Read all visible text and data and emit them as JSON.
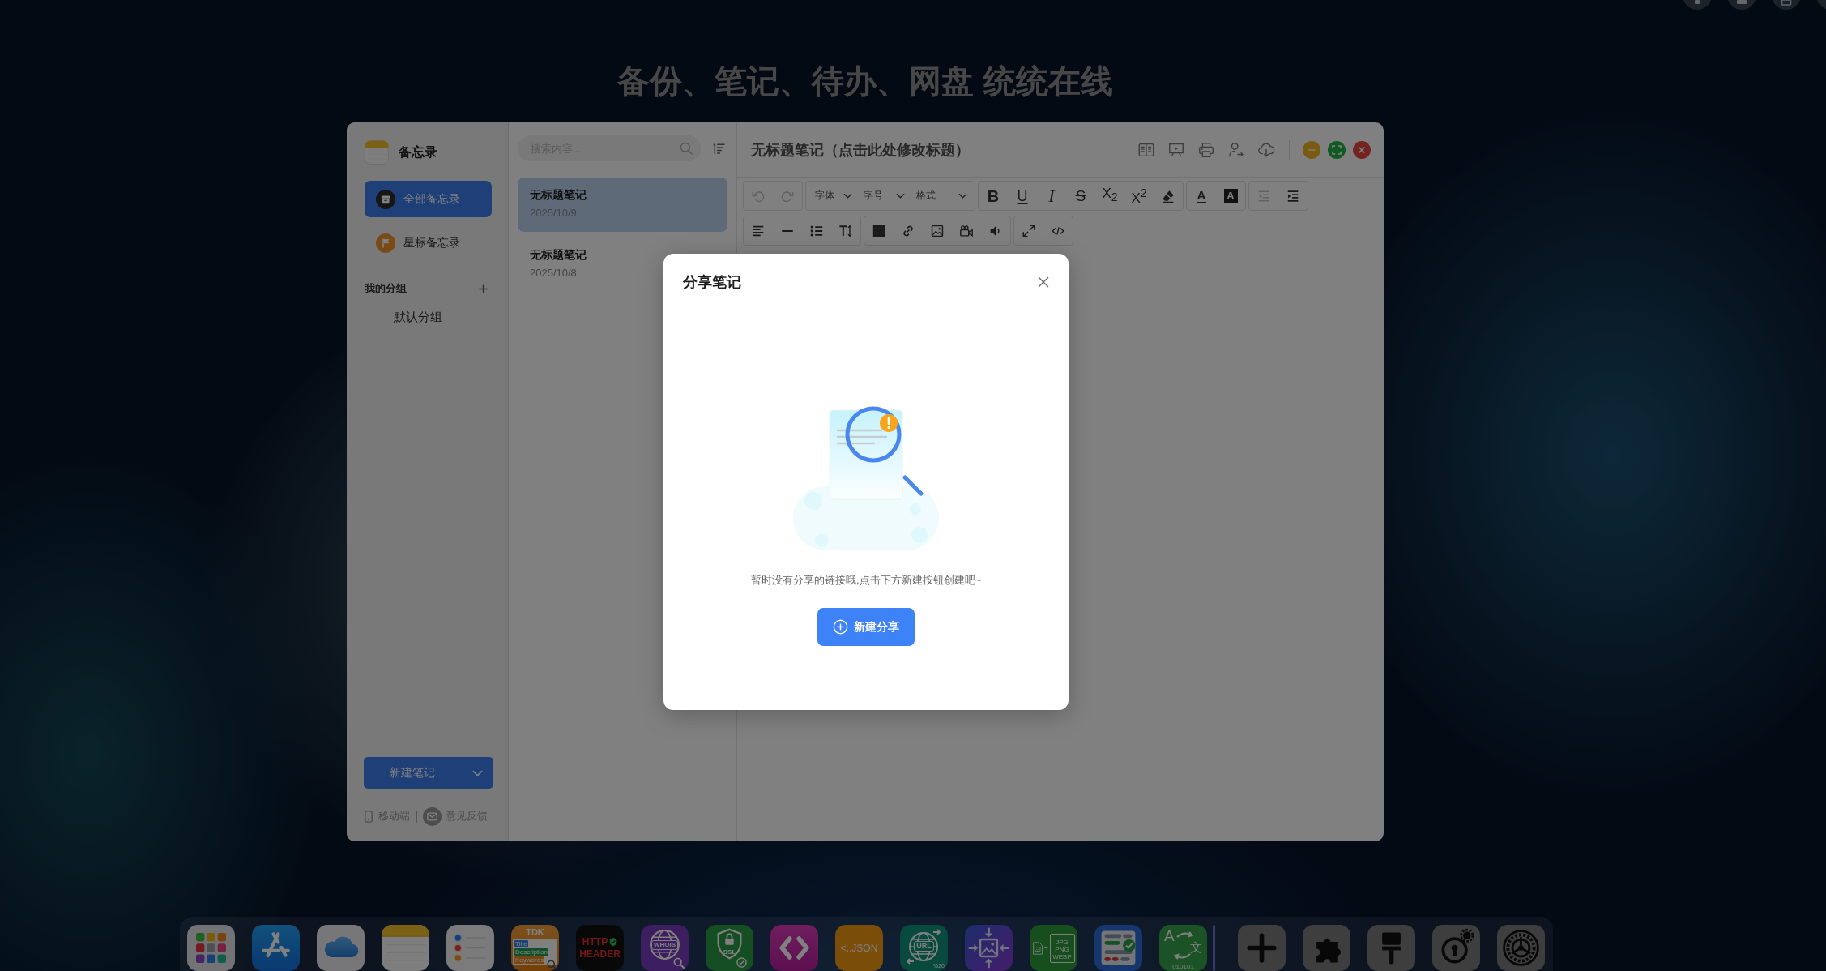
{
  "desktop": {
    "headline": "备份、笔记、待办、网盘 统统在线"
  },
  "sidebar": {
    "app_name": "备忘录",
    "nav": [
      {
        "kind": "all",
        "label": "全部备忘录",
        "selected": true
      },
      {
        "kind": "starred",
        "label": "星标备忘录",
        "selected": false
      }
    ],
    "groups_title": "我的分组",
    "groups": [
      {
        "label": "默认分组",
        "selected": false
      }
    ],
    "new_note": "新建笔记",
    "links": [
      {
        "kind": "mobile",
        "label": "移动端"
      },
      {
        "kind": "feedback",
        "label": "意见反馈"
      }
    ]
  },
  "note_list": {
    "search": {
      "placeholder": "搜索内容..."
    },
    "notes": [
      {
        "title": "无标题笔记",
        "date": "2025/10/9",
        "selected": true
      },
      {
        "title": "无标题笔记",
        "date": "2025/10/8",
        "selected": false
      }
    ]
  },
  "editor": {
    "title": "无标题笔记（点击此处修改标题）",
    "actions": [
      {
        "kind": "reader"
      },
      {
        "kind": "slides"
      },
      {
        "kind": "print"
      },
      {
        "kind": "share"
      },
      {
        "kind": "cloud"
      }
    ],
    "window_controls": [
      {
        "kind": "minimize"
      },
      {
        "kind": "maximize"
      },
      {
        "kind": "close"
      }
    ],
    "toolbar_rows": [
      {
        "groups": [
          {
            "items": [
              {
                "kind": "undo",
                "disabled": true
              },
              {
                "kind": "redo",
                "disabled": true
              }
            ]
          },
          {
            "items": [
              {
                "kind": "select",
                "label": "字体",
                "disabled": false
              },
              {
                "kind": "select",
                "label": "字号",
                "disabled": false
              },
              {
                "kind": "select",
                "label": "格式",
                "disabled": false
              }
            ]
          },
          {
            "items": [
              {
                "kind": "bold",
                "label": "B",
                "disabled": false
              },
              {
                "kind": "underline",
                "label": "U",
                "disabled": false
              },
              {
                "kind": "italic",
                "label": "I",
                "disabled": false
              },
              {
                "kind": "strike",
                "label": "S",
                "disabled": false
              },
              {
                "kind": "subscript",
                "label": "X$_{2}$",
                "disabled": false
              },
              {
                "kind": "superscript",
                "label": "X$^{2}$",
                "disabled": false
              },
              {
                "kind": "eraser",
                "disabled": false
              }
            ]
          },
          {
            "items": [
              {
                "kind": "fontcolor",
                "label": "A",
                "disabled": false
              },
              {
                "kind": "highlight",
                "label": "A",
                "disabled": false
              }
            ]
          },
          {
            "items": [
              {
                "kind": "outdent",
                "disabled": true
              },
              {
                "kind": "indent",
                "disabled": false
              }
            ]
          }
        ]
      },
      {
        "groups": [
          {
            "items": [
              {
                "kind": "align",
                "disabled": false
              },
              {
                "kind": "rule",
                "disabled": false
              },
              {
                "kind": "ordered",
                "disabled": false
              },
              {
                "kind": "lineheight",
                "disabled": false
              }
            ]
          },
          {
            "items": [
              {
                "kind": "table",
                "disabled": false
              },
              {
                "kind": "link",
                "disabled": false
              },
              {
                "kind": "image",
                "disabled": false
              },
              {
                "kind": "video",
                "disabled": false
              },
              {
                "kind": "audio",
                "disabled": false
              }
            ]
          },
          {
            "items": [
              {
                "kind": "fullscreen",
                "disabled": false
              },
              {
                "kind": "code",
                "disabled": false
              }
            ]
          }
        ]
      }
    ]
  },
  "dialog": {
    "title": "分享笔记",
    "message": "暂时没有分享的链接哦,点击下方新建按钮创建吧~",
    "button": "新建分享"
  },
  "dock": {
    "apps": [
      {
        "kind": "launchpad"
      },
      {
        "kind": "store"
      },
      {
        "kind": "cloud"
      },
      {
        "kind": "notes"
      },
      {
        "kind": "reminders"
      },
      {
        "kind": "tdk",
        "title": "TDK",
        "fields": [
          "Title",
          "Description",
          "Keywords"
        ]
      },
      {
        "kind": "http",
        "lines": [
          "HTTP",
          "HEADER"
        ]
      },
      {
        "kind": "whois",
        "title": "WHOIS"
      },
      {
        "kind": "ssl",
        "title": "SSL"
      },
      {
        "kind": "code"
      },
      {
        "kind": "json",
        "title": "<..JSON"
      },
      {
        "kind": "url",
        "title": "URL",
        "note": "%20"
      },
      {
        "kind": "compress"
      },
      {
        "kind": "convert",
        "formats": [
          "JPG",
          "PNG",
          "WEBP"
        ]
      },
      {
        "kind": "form"
      },
      {
        "kind": "translate",
        "source": "A",
        "target": "文",
        "note": "010101"
      }
    ],
    "tools": [
      {
        "kind": "add"
      },
      {
        "kind": "plugin"
      },
      {
        "kind": "brush"
      },
      {
        "kind": "keyhole"
      },
      {
        "kind": "settings"
      }
    ]
  }
}
